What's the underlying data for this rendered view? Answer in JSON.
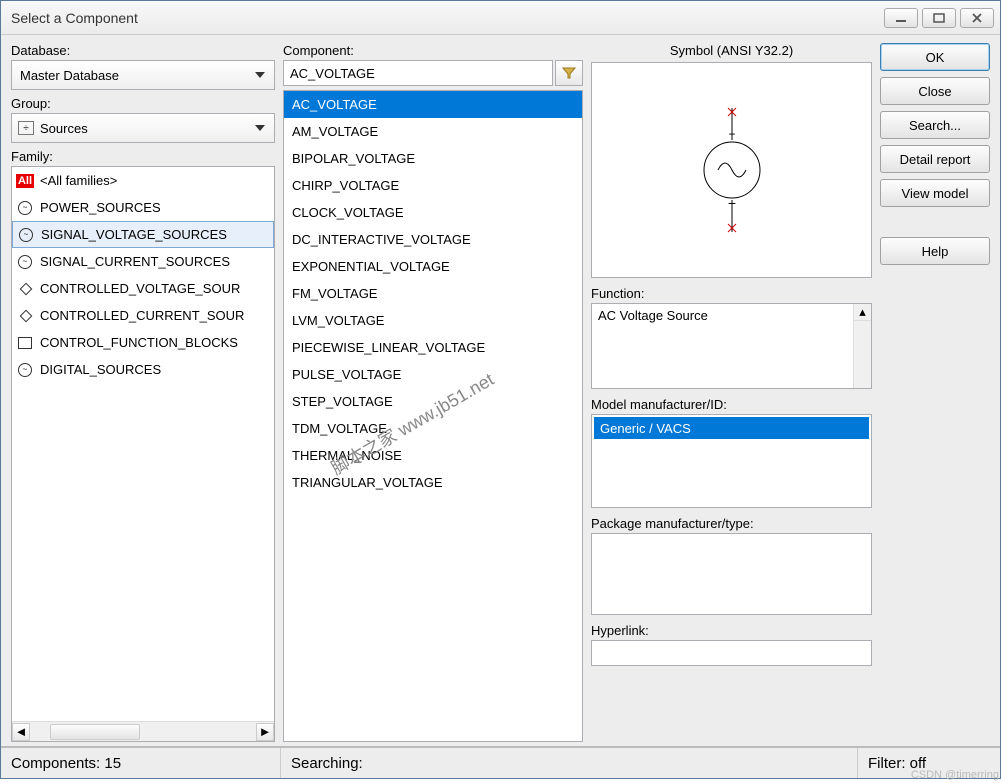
{
  "window_title": "Select a Component",
  "labels": {
    "database": "Database:",
    "group": "Group:",
    "family": "Family:",
    "component": "Component:",
    "symbol": "Symbol (ANSI Y32.2)",
    "function": "Function:",
    "model_manufacturer": "Model manufacturer/ID:",
    "package_manufacturer": "Package manufacturer/type:",
    "hyperlink": "Hyperlink:"
  },
  "database": {
    "selected": "Master Database"
  },
  "group": {
    "selected": "Sources"
  },
  "family": {
    "items": [
      {
        "label": "<All families>",
        "icon": "all"
      },
      {
        "label": "POWER_SOURCES",
        "icon": "circle"
      },
      {
        "label": "SIGNAL_VOLTAGE_SOURCES",
        "icon": "circle",
        "selected": true
      },
      {
        "label": "SIGNAL_CURRENT_SOURCES",
        "icon": "circle"
      },
      {
        "label": "CONTROLLED_VOLTAGE_SOUR",
        "icon": "diamond"
      },
      {
        "label": "CONTROLLED_CURRENT_SOUR",
        "icon": "diamond"
      },
      {
        "label": "CONTROL_FUNCTION_BLOCKS",
        "icon": "box"
      },
      {
        "label": "DIGITAL_SOURCES",
        "icon": "circle"
      }
    ]
  },
  "component": {
    "value": "AC_VOLTAGE",
    "items": [
      "AC_VOLTAGE",
      "AM_VOLTAGE",
      "BIPOLAR_VOLTAGE",
      "CHIRP_VOLTAGE",
      "CLOCK_VOLTAGE",
      "DC_INTERACTIVE_VOLTAGE",
      "EXPONENTIAL_VOLTAGE",
      "FM_VOLTAGE",
      "LVM_VOLTAGE",
      "PIECEWISE_LINEAR_VOLTAGE",
      "PULSE_VOLTAGE",
      "STEP_VOLTAGE",
      "TDM_VOLTAGE",
      "THERMAL_NOISE",
      "TRIANGULAR_VOLTAGE"
    ],
    "selected_index": 0
  },
  "function_text": "AC Voltage Source",
  "model_manufacturer": {
    "items": [
      "Generic / VACS"
    ],
    "selected_index": 0
  },
  "buttons": {
    "ok": "OK",
    "close": "Close",
    "search": "Search...",
    "detail_report": "Detail report",
    "view_model": "View model",
    "help": "Help"
  },
  "status": {
    "components": "Components: 15",
    "searching": "Searching:",
    "filter": "Filter: off"
  },
  "watermark": "脚本之家 www.jb51.net",
  "credit": "CSDN @timerring"
}
